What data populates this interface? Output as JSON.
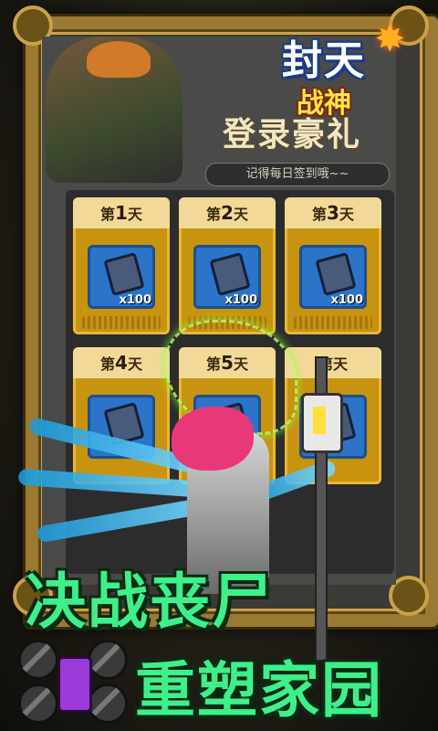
{
  "logo": {
    "line1": "封天",
    "line2": "战神",
    "star": "✸"
  },
  "event": {
    "title": "登录豪礼",
    "subtitle": "记得每日签到哦~~"
  },
  "days": [
    {
      "prefix": "第",
      "num": "1",
      "suffix": "天",
      "qty": "x100"
    },
    {
      "prefix": "第",
      "num": "2",
      "suffix": "天",
      "qty": "x100"
    },
    {
      "prefix": "第",
      "num": "3",
      "suffix": "天",
      "qty": "x100"
    },
    {
      "prefix": "第",
      "num": "4",
      "suffix": "天",
      "qty": ""
    },
    {
      "prefix": "第",
      "num": "5",
      "suffix": "天",
      "qty": ""
    },
    {
      "prefix": "第",
      "num": "",
      "suffix": "天",
      "qty": ""
    }
  ],
  "slogans": {
    "line1": "决战丧尸",
    "line2": "重塑家园"
  },
  "colors": {
    "frame": "#9a7a32",
    "card": "#c8930f",
    "slogan": "#3ef08a",
    "item_bg": "#2b74c8"
  }
}
